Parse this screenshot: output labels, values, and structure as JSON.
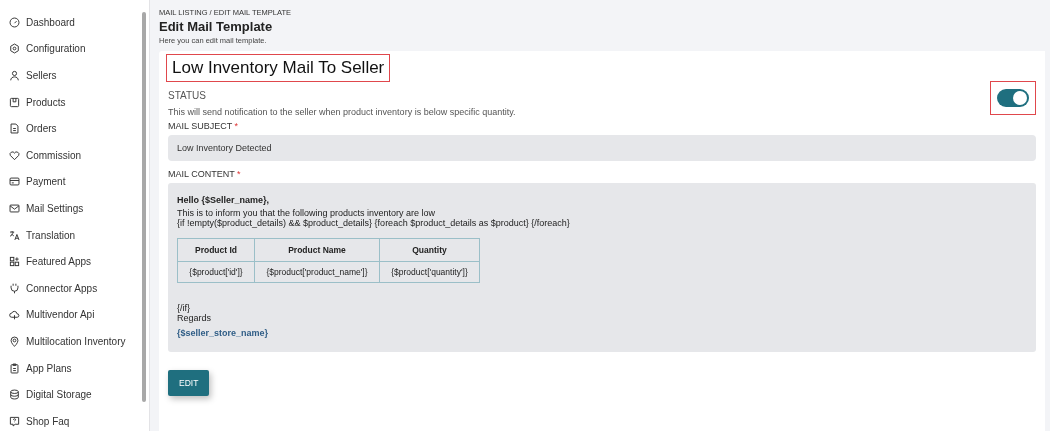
{
  "sidebar": {
    "items": [
      {
        "label": "Dashboard"
      },
      {
        "label": "Configuration"
      },
      {
        "label": "Sellers"
      },
      {
        "label": "Products"
      },
      {
        "label": "Orders"
      },
      {
        "label": "Commission"
      },
      {
        "label": "Payment"
      },
      {
        "label": "Mail Settings"
      },
      {
        "label": "Translation"
      },
      {
        "label": "Featured Apps"
      },
      {
        "label": "Connector Apps"
      },
      {
        "label": "Multivendor Api"
      },
      {
        "label": "Multilocation Inventory"
      },
      {
        "label": "App Plans"
      },
      {
        "label": "Digital Storage"
      },
      {
        "label": "Shop Faq"
      }
    ]
  },
  "header": {
    "breadcrumb": "MAIL LISTING / EDIT MAIL TEMPLATE",
    "title": "Edit Mail Template",
    "subtitle": "Here you can edit mail template."
  },
  "template": {
    "name": "Low Inventory Mail To Seller",
    "name_highlighted": true,
    "status": {
      "label": "STATUS",
      "description": "This will send notification to the seller when product inventory is below specific quantity.",
      "on": true,
      "highlighted": true
    },
    "subject": {
      "label": "MAIL SUBJECT",
      "required": "*",
      "value": "Low Inventory Detected"
    },
    "content": {
      "label": "MAIL CONTENT",
      "required": "*",
      "greeting": "Hello {$Seller_name},",
      "lines": [
        "This is to inform you that the following products inventory are low",
        "{if !empty($product_details) && $product_details} {foreach $product_details as $product} {/foreach}"
      ],
      "table": {
        "columns": [
          "Product Id",
          "Product Name",
          "Quantity"
        ],
        "rows": [
          [
            "{$product['id']}",
            "{$product['product_name']}",
            "{$product['quantity']}"
          ]
        ]
      },
      "closing": [
        "{/if}",
        "Regards"
      ],
      "signature": "{$seller_store_name}"
    },
    "edit_button": "EDIT"
  }
}
